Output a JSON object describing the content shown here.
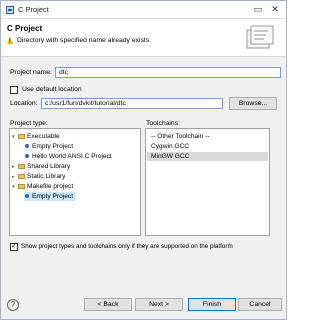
{
  "window": {
    "title": "C Project"
  },
  "header": {
    "title": "C Project",
    "message": "Directory with specified name already exists."
  },
  "project_name": {
    "label": "Project name:",
    "value": "dtc"
  },
  "use_default_location": {
    "label": "Use default location",
    "checked": false
  },
  "location": {
    "label": "Location:",
    "value": "c:/usr1/fun/dvkit/tutorial/dtc",
    "browse_label": "Browse..."
  },
  "project_type": {
    "label": "Project type:",
    "items": [
      {
        "label": "Executable",
        "kind": "folder",
        "expanded": true,
        "level": 0
      },
      {
        "label": "Empty Project",
        "kind": "item",
        "level": 1
      },
      {
        "label": "Hello World ANSI C Project",
        "kind": "item",
        "level": 1
      },
      {
        "label": "Shared Library",
        "kind": "folder",
        "expanded": false,
        "level": 0
      },
      {
        "label": "Static Library",
        "kind": "folder",
        "expanded": false,
        "level": 0
      },
      {
        "label": "Makefile project",
        "kind": "folder",
        "expanded": true,
        "level": 0
      },
      {
        "label": "Empty Project",
        "kind": "item",
        "level": 1,
        "selected": true
      }
    ]
  },
  "toolchains": {
    "label": "Toolchains:",
    "items": [
      {
        "label": "-- Other Toolchain --"
      },
      {
        "label": "Cygwin GCC"
      },
      {
        "label": "MinGW GCC",
        "selected": true
      }
    ]
  },
  "show_supported": {
    "label": "Show project types and toolchains only if they are supported on the platform",
    "checked": true
  },
  "buttons": {
    "back": "< Back",
    "next": "Next >",
    "finish": "Finish",
    "cancel": "Cancel"
  }
}
